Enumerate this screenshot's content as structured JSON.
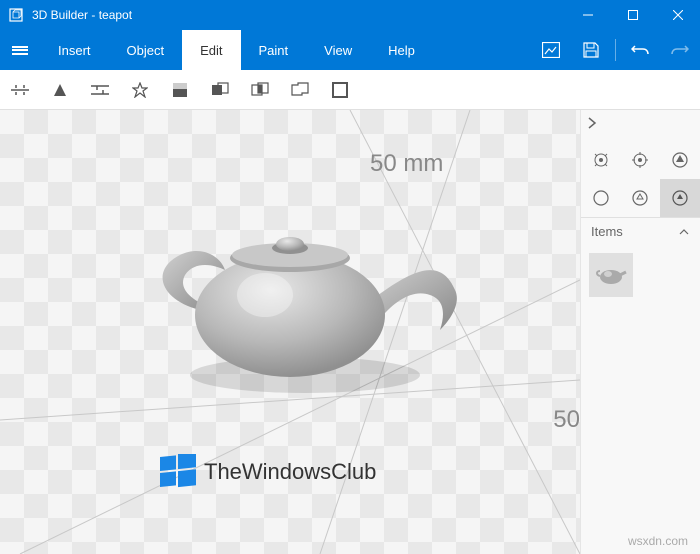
{
  "titlebar": {
    "app_name": "3D Builder - teapot"
  },
  "menu": {
    "insert": "Insert",
    "object": "Object",
    "edit": "Edit",
    "paint": "Paint",
    "view": "View",
    "help": "Help"
  },
  "viewport": {
    "dimension_label_1": "50 mm",
    "dimension_label_2": "50"
  },
  "sidepanel": {
    "items_header": "Items"
  },
  "watermark": {
    "text": "TheWindowsClub"
  },
  "footer": {
    "source": "wsxdn.com"
  }
}
